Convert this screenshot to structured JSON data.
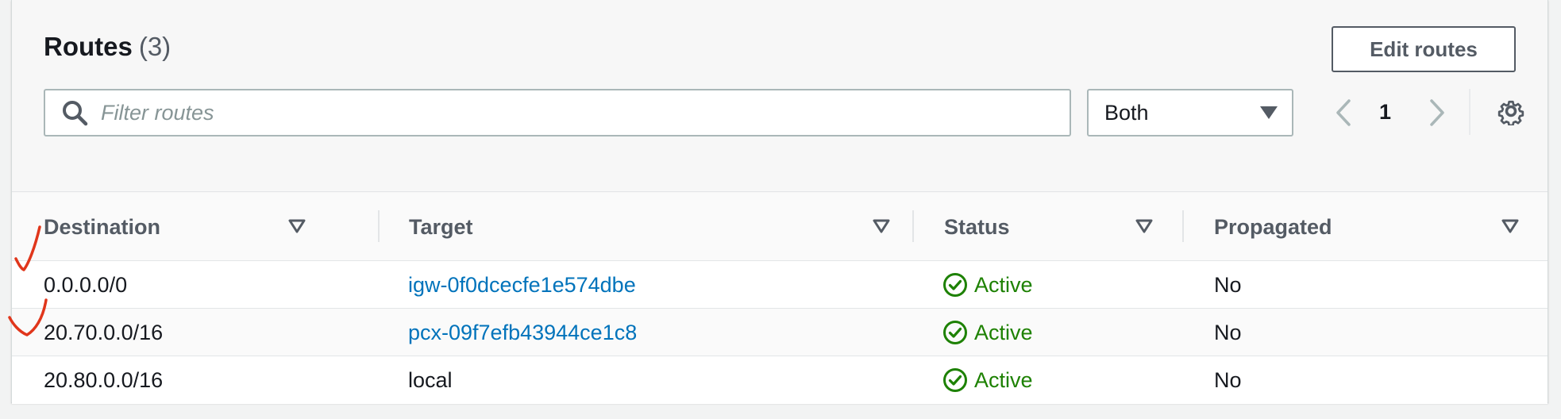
{
  "header": {
    "title": "Routes",
    "count": "(3)",
    "edit_label": "Edit routes"
  },
  "filter": {
    "placeholder": "Filter routes",
    "value": "",
    "select_value": "Both"
  },
  "pagination": {
    "current_page": "1"
  },
  "table": {
    "columns": [
      "Destination",
      "Target",
      "Status",
      "Propagated"
    ],
    "rows": [
      {
        "destination": "0.0.0.0/0",
        "target": "igw-0f0dcecfe1e574dbe",
        "target_is_link": true,
        "status": "Active",
        "propagated": "No"
      },
      {
        "destination": "20.70.0.0/16",
        "target": "pcx-09f7efb43944ce1c8",
        "target_is_link": true,
        "status": "Active",
        "propagated": "No"
      },
      {
        "destination": "20.80.0.0/16",
        "target": "local",
        "target_is_link": false,
        "status": "Active",
        "propagated": "No"
      }
    ]
  },
  "icons": {
    "search": "search-icon",
    "dropdown": "caret-down-icon",
    "prev": "chevron-left-icon",
    "next": "chevron-right-icon",
    "settings": "gear-icon",
    "sort": "sort-caret-icon",
    "status": "check-circle-icon",
    "annotation": "handwritten-checkmark"
  },
  "colors": {
    "link": "#0073bb",
    "status_active": "#1d8102",
    "annotation": "#e0361b",
    "border": "#aab7b8"
  }
}
